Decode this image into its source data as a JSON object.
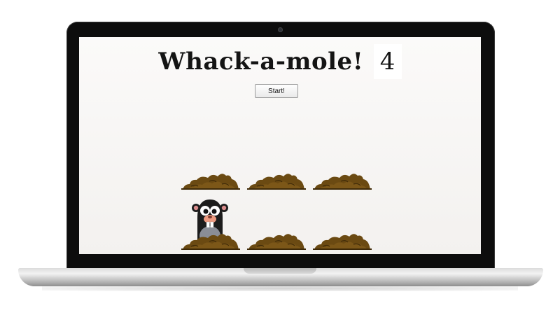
{
  "game": {
    "title": "Whack-a-mole!",
    "score": "4",
    "start_label": "Start!"
  },
  "board": {
    "rows": 2,
    "cols": 3,
    "holes": [
      {
        "index": 0,
        "has_mole": false
      },
      {
        "index": 1,
        "has_mole": false
      },
      {
        "index": 2,
        "has_mole": false
      },
      {
        "index": 3,
        "has_mole": true
      },
      {
        "index": 4,
        "has_mole": false
      },
      {
        "index": 5,
        "has_mole": false
      }
    ]
  },
  "icons": {
    "mole": "mole-icon",
    "dirt": "dirt-mound-icon",
    "camera": "camera-icon"
  },
  "colors": {
    "screen_bg": "#f7f5f3",
    "dirt": "#6b4a12",
    "dirt_dark": "#3f2a08",
    "mole_body": "#1c1c1c",
    "mole_belly": "#8a8d96",
    "mole_nose": "#ee9a80",
    "bezel": "#0d0d0d"
  }
}
